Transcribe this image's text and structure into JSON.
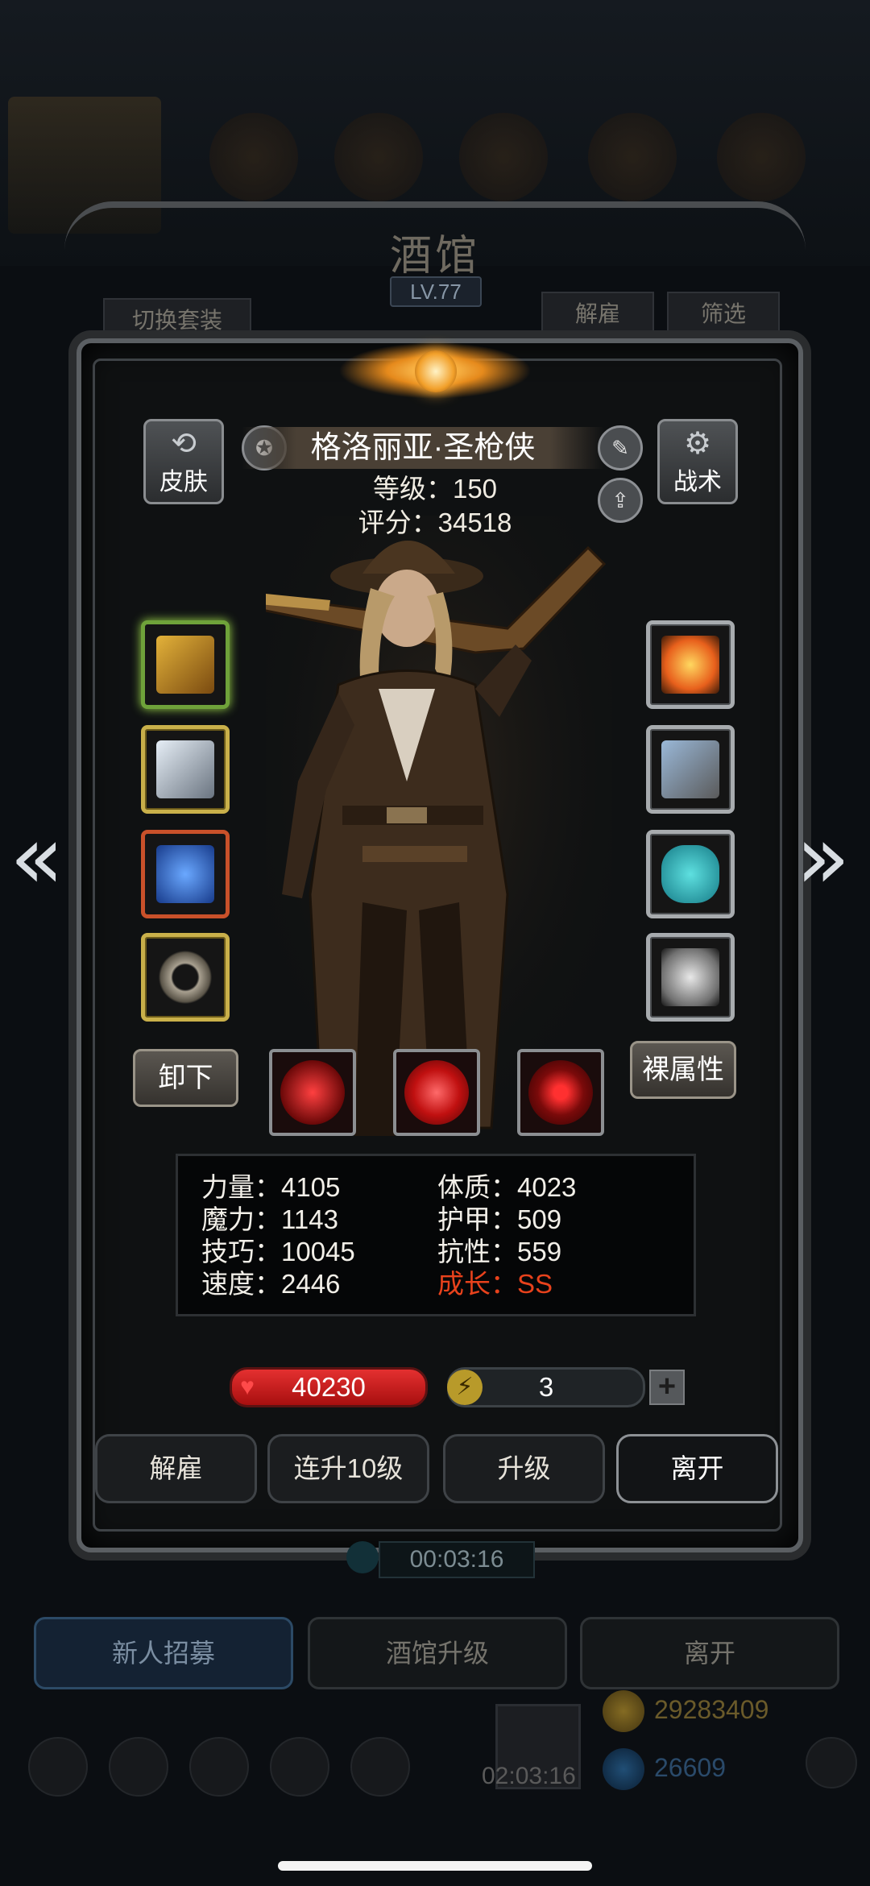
{
  "background": {
    "title": "酒馆",
    "level": "LV.77",
    "switch_outfit": "切换套装",
    "dismiss_label": "解雇",
    "filter_label": "筛选",
    "timer": "00:03:16",
    "bottom_tabs": [
      "新人招募",
      "酒馆升级",
      "离开"
    ],
    "gold": "29283409",
    "gems": "26609",
    "bottom_timer": "02:03:16"
  },
  "hero": {
    "name": "格洛丽亚·圣枪侠",
    "level_text": "等级：150",
    "score_text": "评分：34518",
    "skin_label": "皮肤",
    "tactics_label": "战术",
    "unequip_label": "卸下",
    "raw_attr_label": "裸属性"
  },
  "stats": {
    "left": [
      "力量：4105",
      "魔力：1143",
      "技巧：10045",
      "速度：2446"
    ],
    "right": [
      "体质：4023",
      "护甲：509",
      "抗性：559"
    ],
    "growth": "成长：SS"
  },
  "bars": {
    "hp": "40230",
    "energy": "3"
  },
  "actions": {
    "dismiss": "解雇",
    "level10": "连升10级",
    "upgrade": "升级",
    "leave": "离开"
  },
  "colors": {
    "growth": "#e8421c",
    "hp_bar": "#d92424",
    "frame": "#5b5f63"
  }
}
